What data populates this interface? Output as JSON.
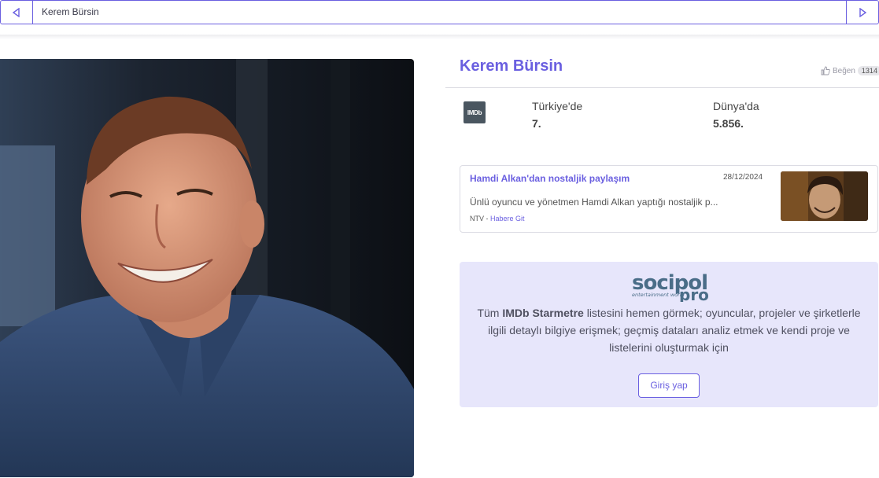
{
  "topbar": {
    "title": "Kerem Bürsin"
  },
  "profile": {
    "name": "Kerem Bürsin",
    "like_label": "Beğen",
    "like_count": "1314"
  },
  "rankings": {
    "logo_text": "IMDb",
    "turkey_label": "Türkiye'de",
    "turkey_value": "7.",
    "world_label": "Dünya'da",
    "world_value": "5.856."
  },
  "news": {
    "title": "Hamdi Alkan'dan nostaljik paylaşım",
    "date": "28/12/2024",
    "excerpt": "Ünlü oyuncu ve yönetmen Hamdi Alkan yaptığı nostaljik p...",
    "source": "NTV",
    "separator": " - ",
    "link_label": "Habere Git"
  },
  "promo": {
    "logo_main": "socipol",
    "logo_sub": "entertainment world",
    "logo_pro": "pro",
    "text_prefix": "Tüm ",
    "text_bold": "IMDb Starmetre",
    "text_suffix": " listesini hemen görmek; oyuncular, projeler ve şirketlerle ilgili detaylı bilgiye erişmek; geçmiş dataları analiz etmek ve kendi proje ve listelerini oluşturmak için",
    "button_label": "Giriş yap"
  },
  "colors": {
    "accent": "#6a5fe0",
    "promo_bg": "#e7e6fb"
  },
  "icons": {
    "prev": "triangle-left-icon",
    "next": "triangle-right-icon",
    "like": "thumbs-up-icon"
  }
}
